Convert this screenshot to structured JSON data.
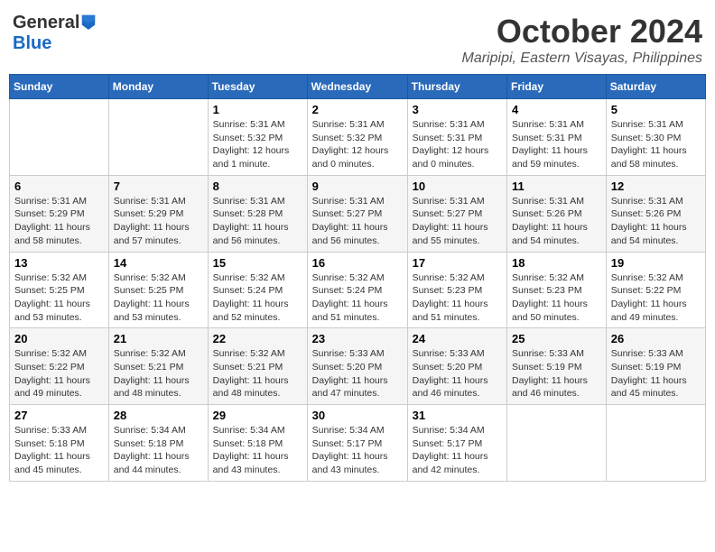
{
  "logo": {
    "text1": "General",
    "text2": "Blue"
  },
  "title": "October 2024",
  "location": "Maripipi, Eastern Visayas, Philippines",
  "days_header": [
    "Sunday",
    "Monday",
    "Tuesday",
    "Wednesday",
    "Thursday",
    "Friday",
    "Saturday"
  ],
  "weeks": [
    [
      {
        "day": "",
        "info": ""
      },
      {
        "day": "",
        "info": ""
      },
      {
        "day": "1",
        "info": "Sunrise: 5:31 AM\nSunset: 5:32 PM\nDaylight: 12 hours\nand 1 minute."
      },
      {
        "day": "2",
        "info": "Sunrise: 5:31 AM\nSunset: 5:32 PM\nDaylight: 12 hours\nand 0 minutes."
      },
      {
        "day": "3",
        "info": "Sunrise: 5:31 AM\nSunset: 5:31 PM\nDaylight: 12 hours\nand 0 minutes."
      },
      {
        "day": "4",
        "info": "Sunrise: 5:31 AM\nSunset: 5:31 PM\nDaylight: 11 hours\nand 59 minutes."
      },
      {
        "day": "5",
        "info": "Sunrise: 5:31 AM\nSunset: 5:30 PM\nDaylight: 11 hours\nand 58 minutes."
      }
    ],
    [
      {
        "day": "6",
        "info": "Sunrise: 5:31 AM\nSunset: 5:29 PM\nDaylight: 11 hours\nand 58 minutes."
      },
      {
        "day": "7",
        "info": "Sunrise: 5:31 AM\nSunset: 5:29 PM\nDaylight: 11 hours\nand 57 minutes."
      },
      {
        "day": "8",
        "info": "Sunrise: 5:31 AM\nSunset: 5:28 PM\nDaylight: 11 hours\nand 56 minutes."
      },
      {
        "day": "9",
        "info": "Sunrise: 5:31 AM\nSunset: 5:27 PM\nDaylight: 11 hours\nand 56 minutes."
      },
      {
        "day": "10",
        "info": "Sunrise: 5:31 AM\nSunset: 5:27 PM\nDaylight: 11 hours\nand 55 minutes."
      },
      {
        "day": "11",
        "info": "Sunrise: 5:31 AM\nSunset: 5:26 PM\nDaylight: 11 hours\nand 54 minutes."
      },
      {
        "day": "12",
        "info": "Sunrise: 5:31 AM\nSunset: 5:26 PM\nDaylight: 11 hours\nand 54 minutes."
      }
    ],
    [
      {
        "day": "13",
        "info": "Sunrise: 5:32 AM\nSunset: 5:25 PM\nDaylight: 11 hours\nand 53 minutes."
      },
      {
        "day": "14",
        "info": "Sunrise: 5:32 AM\nSunset: 5:25 PM\nDaylight: 11 hours\nand 53 minutes."
      },
      {
        "day": "15",
        "info": "Sunrise: 5:32 AM\nSunset: 5:24 PM\nDaylight: 11 hours\nand 52 minutes."
      },
      {
        "day": "16",
        "info": "Sunrise: 5:32 AM\nSunset: 5:24 PM\nDaylight: 11 hours\nand 51 minutes."
      },
      {
        "day": "17",
        "info": "Sunrise: 5:32 AM\nSunset: 5:23 PM\nDaylight: 11 hours\nand 51 minutes."
      },
      {
        "day": "18",
        "info": "Sunrise: 5:32 AM\nSunset: 5:23 PM\nDaylight: 11 hours\nand 50 minutes."
      },
      {
        "day": "19",
        "info": "Sunrise: 5:32 AM\nSunset: 5:22 PM\nDaylight: 11 hours\nand 49 minutes."
      }
    ],
    [
      {
        "day": "20",
        "info": "Sunrise: 5:32 AM\nSunset: 5:22 PM\nDaylight: 11 hours\nand 49 minutes."
      },
      {
        "day": "21",
        "info": "Sunrise: 5:32 AM\nSunset: 5:21 PM\nDaylight: 11 hours\nand 48 minutes."
      },
      {
        "day": "22",
        "info": "Sunrise: 5:32 AM\nSunset: 5:21 PM\nDaylight: 11 hours\nand 48 minutes."
      },
      {
        "day": "23",
        "info": "Sunrise: 5:33 AM\nSunset: 5:20 PM\nDaylight: 11 hours\nand 47 minutes."
      },
      {
        "day": "24",
        "info": "Sunrise: 5:33 AM\nSunset: 5:20 PM\nDaylight: 11 hours\nand 46 minutes."
      },
      {
        "day": "25",
        "info": "Sunrise: 5:33 AM\nSunset: 5:19 PM\nDaylight: 11 hours\nand 46 minutes."
      },
      {
        "day": "26",
        "info": "Sunrise: 5:33 AM\nSunset: 5:19 PM\nDaylight: 11 hours\nand 45 minutes."
      }
    ],
    [
      {
        "day": "27",
        "info": "Sunrise: 5:33 AM\nSunset: 5:18 PM\nDaylight: 11 hours\nand 45 minutes."
      },
      {
        "day": "28",
        "info": "Sunrise: 5:34 AM\nSunset: 5:18 PM\nDaylight: 11 hours\nand 44 minutes."
      },
      {
        "day": "29",
        "info": "Sunrise: 5:34 AM\nSunset: 5:18 PM\nDaylight: 11 hours\nand 43 minutes."
      },
      {
        "day": "30",
        "info": "Sunrise: 5:34 AM\nSunset: 5:17 PM\nDaylight: 11 hours\nand 43 minutes."
      },
      {
        "day": "31",
        "info": "Sunrise: 5:34 AM\nSunset: 5:17 PM\nDaylight: 11 hours\nand 42 minutes."
      },
      {
        "day": "",
        "info": ""
      },
      {
        "day": "",
        "info": ""
      }
    ]
  ]
}
